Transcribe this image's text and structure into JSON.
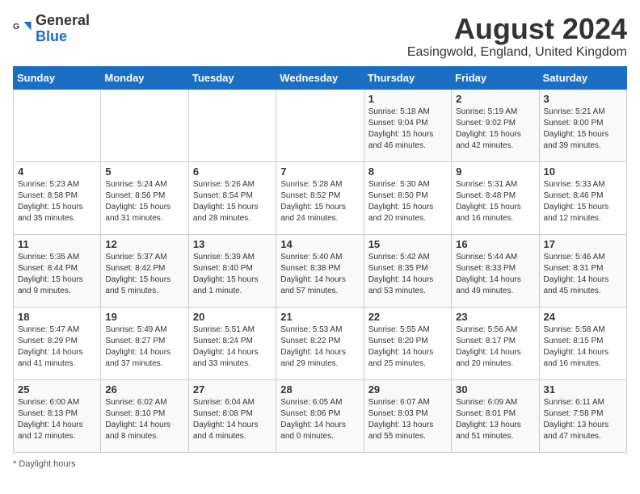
{
  "header": {
    "logo_general": "General",
    "logo_blue": "Blue",
    "month_title": "August 2024",
    "location": "Easingwold, England, United Kingdom"
  },
  "calendar": {
    "days_of_week": [
      "Sunday",
      "Monday",
      "Tuesday",
      "Wednesday",
      "Thursday",
      "Friday",
      "Saturday"
    ],
    "weeks": [
      [
        {
          "day": "",
          "info": ""
        },
        {
          "day": "",
          "info": ""
        },
        {
          "day": "",
          "info": ""
        },
        {
          "day": "",
          "info": ""
        },
        {
          "day": "1",
          "info": "Sunrise: 5:18 AM\nSunset: 9:04 PM\nDaylight: 15 hours\nand 46 minutes."
        },
        {
          "day": "2",
          "info": "Sunrise: 5:19 AM\nSunset: 9:02 PM\nDaylight: 15 hours\nand 42 minutes."
        },
        {
          "day": "3",
          "info": "Sunrise: 5:21 AM\nSunset: 9:00 PM\nDaylight: 15 hours\nand 39 minutes."
        }
      ],
      [
        {
          "day": "4",
          "info": "Sunrise: 5:23 AM\nSunset: 8:58 PM\nDaylight: 15 hours\nand 35 minutes."
        },
        {
          "day": "5",
          "info": "Sunrise: 5:24 AM\nSunset: 8:56 PM\nDaylight: 15 hours\nand 31 minutes."
        },
        {
          "day": "6",
          "info": "Sunrise: 5:26 AM\nSunset: 8:54 PM\nDaylight: 15 hours\nand 28 minutes."
        },
        {
          "day": "7",
          "info": "Sunrise: 5:28 AM\nSunset: 8:52 PM\nDaylight: 15 hours\nand 24 minutes."
        },
        {
          "day": "8",
          "info": "Sunrise: 5:30 AM\nSunset: 8:50 PM\nDaylight: 15 hours\nand 20 minutes."
        },
        {
          "day": "9",
          "info": "Sunrise: 5:31 AM\nSunset: 8:48 PM\nDaylight: 15 hours\nand 16 minutes."
        },
        {
          "day": "10",
          "info": "Sunrise: 5:33 AM\nSunset: 8:46 PM\nDaylight: 15 hours\nand 12 minutes."
        }
      ],
      [
        {
          "day": "11",
          "info": "Sunrise: 5:35 AM\nSunset: 8:44 PM\nDaylight: 15 hours\nand 9 minutes."
        },
        {
          "day": "12",
          "info": "Sunrise: 5:37 AM\nSunset: 8:42 PM\nDaylight: 15 hours\nand 5 minutes."
        },
        {
          "day": "13",
          "info": "Sunrise: 5:39 AM\nSunset: 8:40 PM\nDaylight: 15 hours\nand 1 minute."
        },
        {
          "day": "14",
          "info": "Sunrise: 5:40 AM\nSunset: 8:38 PM\nDaylight: 14 hours\nand 57 minutes."
        },
        {
          "day": "15",
          "info": "Sunrise: 5:42 AM\nSunset: 8:35 PM\nDaylight: 14 hours\nand 53 minutes."
        },
        {
          "day": "16",
          "info": "Sunrise: 5:44 AM\nSunset: 8:33 PM\nDaylight: 14 hours\nand 49 minutes."
        },
        {
          "day": "17",
          "info": "Sunrise: 5:46 AM\nSunset: 8:31 PM\nDaylight: 14 hours\nand 45 minutes."
        }
      ],
      [
        {
          "day": "18",
          "info": "Sunrise: 5:47 AM\nSunset: 8:29 PM\nDaylight: 14 hours\nand 41 minutes."
        },
        {
          "day": "19",
          "info": "Sunrise: 5:49 AM\nSunset: 8:27 PM\nDaylight: 14 hours\nand 37 minutes."
        },
        {
          "day": "20",
          "info": "Sunrise: 5:51 AM\nSunset: 8:24 PM\nDaylight: 14 hours\nand 33 minutes."
        },
        {
          "day": "21",
          "info": "Sunrise: 5:53 AM\nSunset: 8:22 PM\nDaylight: 14 hours\nand 29 minutes."
        },
        {
          "day": "22",
          "info": "Sunrise: 5:55 AM\nSunset: 8:20 PM\nDaylight: 14 hours\nand 25 minutes."
        },
        {
          "day": "23",
          "info": "Sunrise: 5:56 AM\nSunset: 8:17 PM\nDaylight: 14 hours\nand 20 minutes."
        },
        {
          "day": "24",
          "info": "Sunrise: 5:58 AM\nSunset: 8:15 PM\nDaylight: 14 hours\nand 16 minutes."
        }
      ],
      [
        {
          "day": "25",
          "info": "Sunrise: 6:00 AM\nSunset: 8:13 PM\nDaylight: 14 hours\nand 12 minutes."
        },
        {
          "day": "26",
          "info": "Sunrise: 6:02 AM\nSunset: 8:10 PM\nDaylight: 14 hours\nand 8 minutes."
        },
        {
          "day": "27",
          "info": "Sunrise: 6:04 AM\nSunset: 8:08 PM\nDaylight: 14 hours\nand 4 minutes."
        },
        {
          "day": "28",
          "info": "Sunrise: 6:05 AM\nSunset: 8:06 PM\nDaylight: 14 hours\nand 0 minutes."
        },
        {
          "day": "29",
          "info": "Sunrise: 6:07 AM\nSunset: 8:03 PM\nDaylight: 13 hours\nand 55 minutes."
        },
        {
          "day": "30",
          "info": "Sunrise: 6:09 AM\nSunset: 8:01 PM\nDaylight: 13 hours\nand 51 minutes."
        },
        {
          "day": "31",
          "info": "Sunrise: 6:11 AM\nSunset: 7:58 PM\nDaylight: 13 hours\nand 47 minutes."
        }
      ]
    ]
  },
  "footer": {
    "note": "Daylight hours"
  }
}
